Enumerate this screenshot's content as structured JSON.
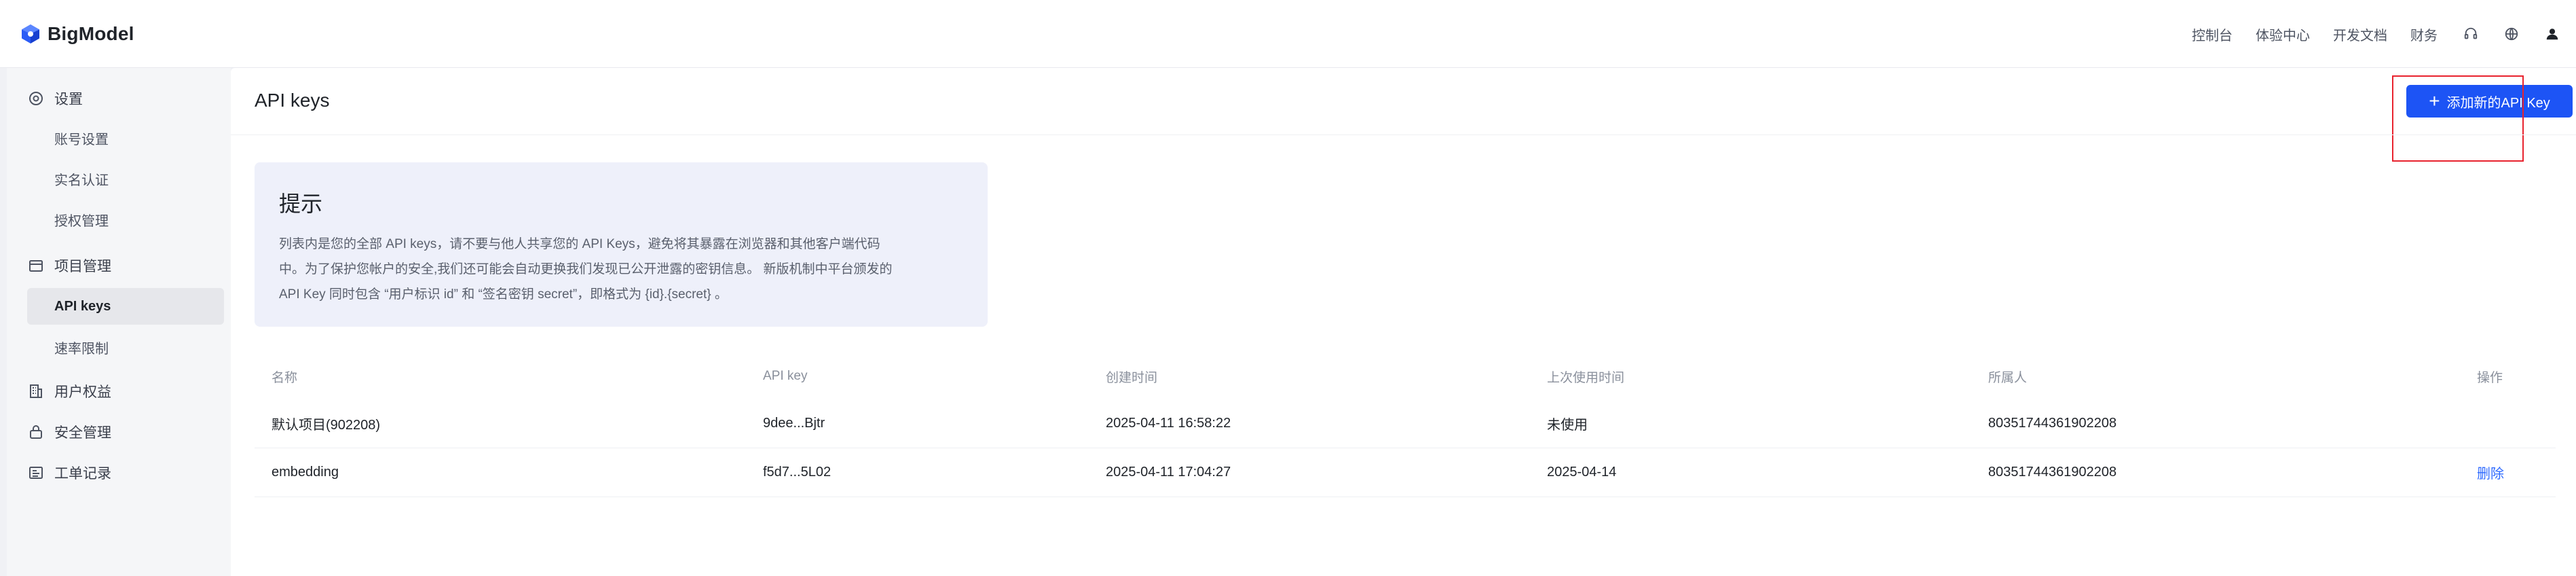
{
  "app": {
    "brand": "BigModel"
  },
  "topnav": {
    "links": [
      "控制台",
      "体验中心",
      "开发文档",
      "财务"
    ],
    "icons": [
      "headset-icon",
      "globe-icon",
      "user-icon"
    ]
  },
  "sidebar": {
    "groups": [
      {
        "label": "设置",
        "icon": "settings-icon",
        "children": [
          "账号设置",
          "实名认证",
          "授权管理"
        ]
      },
      {
        "label": "项目管理",
        "icon": "folder-icon",
        "children": [
          "API keys",
          "速率限制"
        ]
      },
      {
        "label": "用户权益",
        "icon": "building-icon",
        "children": []
      },
      {
        "label": "安全管理",
        "icon": "lock-icon",
        "children": []
      },
      {
        "label": "工单记录",
        "icon": "ticket-icon",
        "children": []
      }
    ],
    "active_item": "API keys"
  },
  "main": {
    "title": "API keys",
    "add_button": "添加新的API Key",
    "tip": {
      "title": "提示",
      "lines": [
        "列表内是您的全部 API keys，请不要与他人共享您的 API Keys，避免将其暴露在浏览器和其他客户端代码",
        "中。为了保护您帐户的安全,我们还可能会自动更换我们发现已公开泄露的密钥信息。 新版机制中平台颁发的",
        "API Key 同时包含 “用户标识 id” 和 “签名密钥 secret”，即格式为 {id}.{secret} 。"
      ]
    },
    "table": {
      "columns": [
        "名称",
        "API key",
        "创建时间",
        "上次使用时间",
        "所属人",
        "操作"
      ],
      "rows": [
        {
          "name": "默认项目(902208)",
          "key": "9dee...Bjtr",
          "created": "2025-04-11 16:58:22",
          "last_used": "未使用",
          "owner": "80351744361902208",
          "action": ""
        },
        {
          "name": "embedding",
          "key": "f5d7...5L02",
          "created": "2025-04-11 17:04:27",
          "last_used": "2025-04-14",
          "owner": "80351744361902208",
          "action": "删除"
        }
      ]
    }
  },
  "colors": {
    "primary": "#1d54f5",
    "link": "#2f6bff",
    "highlight": "#e8232e"
  }
}
